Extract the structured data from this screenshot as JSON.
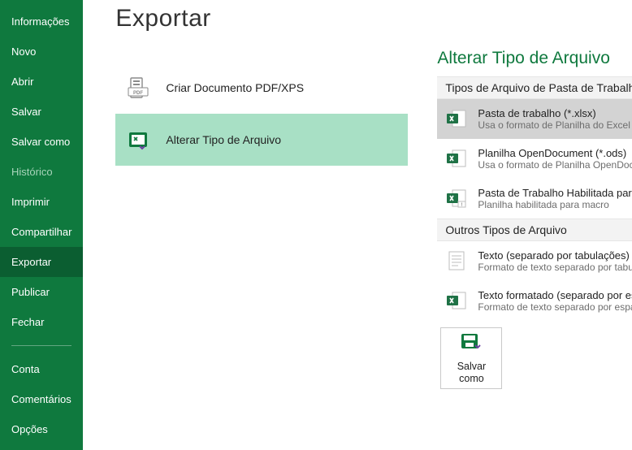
{
  "sidebar": {
    "items": [
      {
        "label": "Informações"
      },
      {
        "label": "Novo"
      },
      {
        "label": "Abrir"
      },
      {
        "label": "Salvar"
      },
      {
        "label": "Salvar como"
      },
      {
        "label": "Histórico",
        "dim": true
      },
      {
        "label": "Imprimir"
      },
      {
        "label": "Compartilhar"
      },
      {
        "label": "Exportar",
        "selected": true
      },
      {
        "label": "Publicar"
      },
      {
        "label": "Fechar"
      }
    ],
    "footer_items": [
      {
        "label": "Conta"
      },
      {
        "label": "Comentários"
      },
      {
        "label": "Opções"
      }
    ]
  },
  "page": {
    "title": "Exportar",
    "export_options": [
      {
        "label": "Criar Documento PDF/XPS",
        "icon": "pdf"
      },
      {
        "label": "Alterar Tipo de Arquivo",
        "icon": "disk",
        "selected": true
      }
    ]
  },
  "right": {
    "title": "Alterar Tipo de Arquivo",
    "sections": [
      {
        "heading": "Tipos de Arquivo de Pasta de Trabalho",
        "items": [
          {
            "title": "Pasta de trabalho (*.xlsx)",
            "desc": "Usa o formato de Planilha do Excel",
            "icon": "xlsx",
            "selected": true
          },
          {
            "title": "Planilha OpenDocument (*.ods)",
            "desc": "Usa o formato de Planilha OpenDocument",
            "icon": "ods"
          },
          {
            "title": "Pasta de Trabalho Habilitada para Macr...",
            "desc": "Planilha habilitada para macro",
            "icon": "xlsm"
          }
        ]
      },
      {
        "heading": "Outros Tipos de Arquivo",
        "items": [
          {
            "title": "Texto (separado por tabulações) (*.txt)",
            "desc": "Formato de texto separado por tabulações",
            "icon": "txt"
          },
          {
            "title": "Texto formatado (separado por espaços...",
            "desc": "Formato de texto separado por espaços",
            "icon": "prn"
          }
        ]
      }
    ],
    "save_as_label": "Salvar como"
  }
}
